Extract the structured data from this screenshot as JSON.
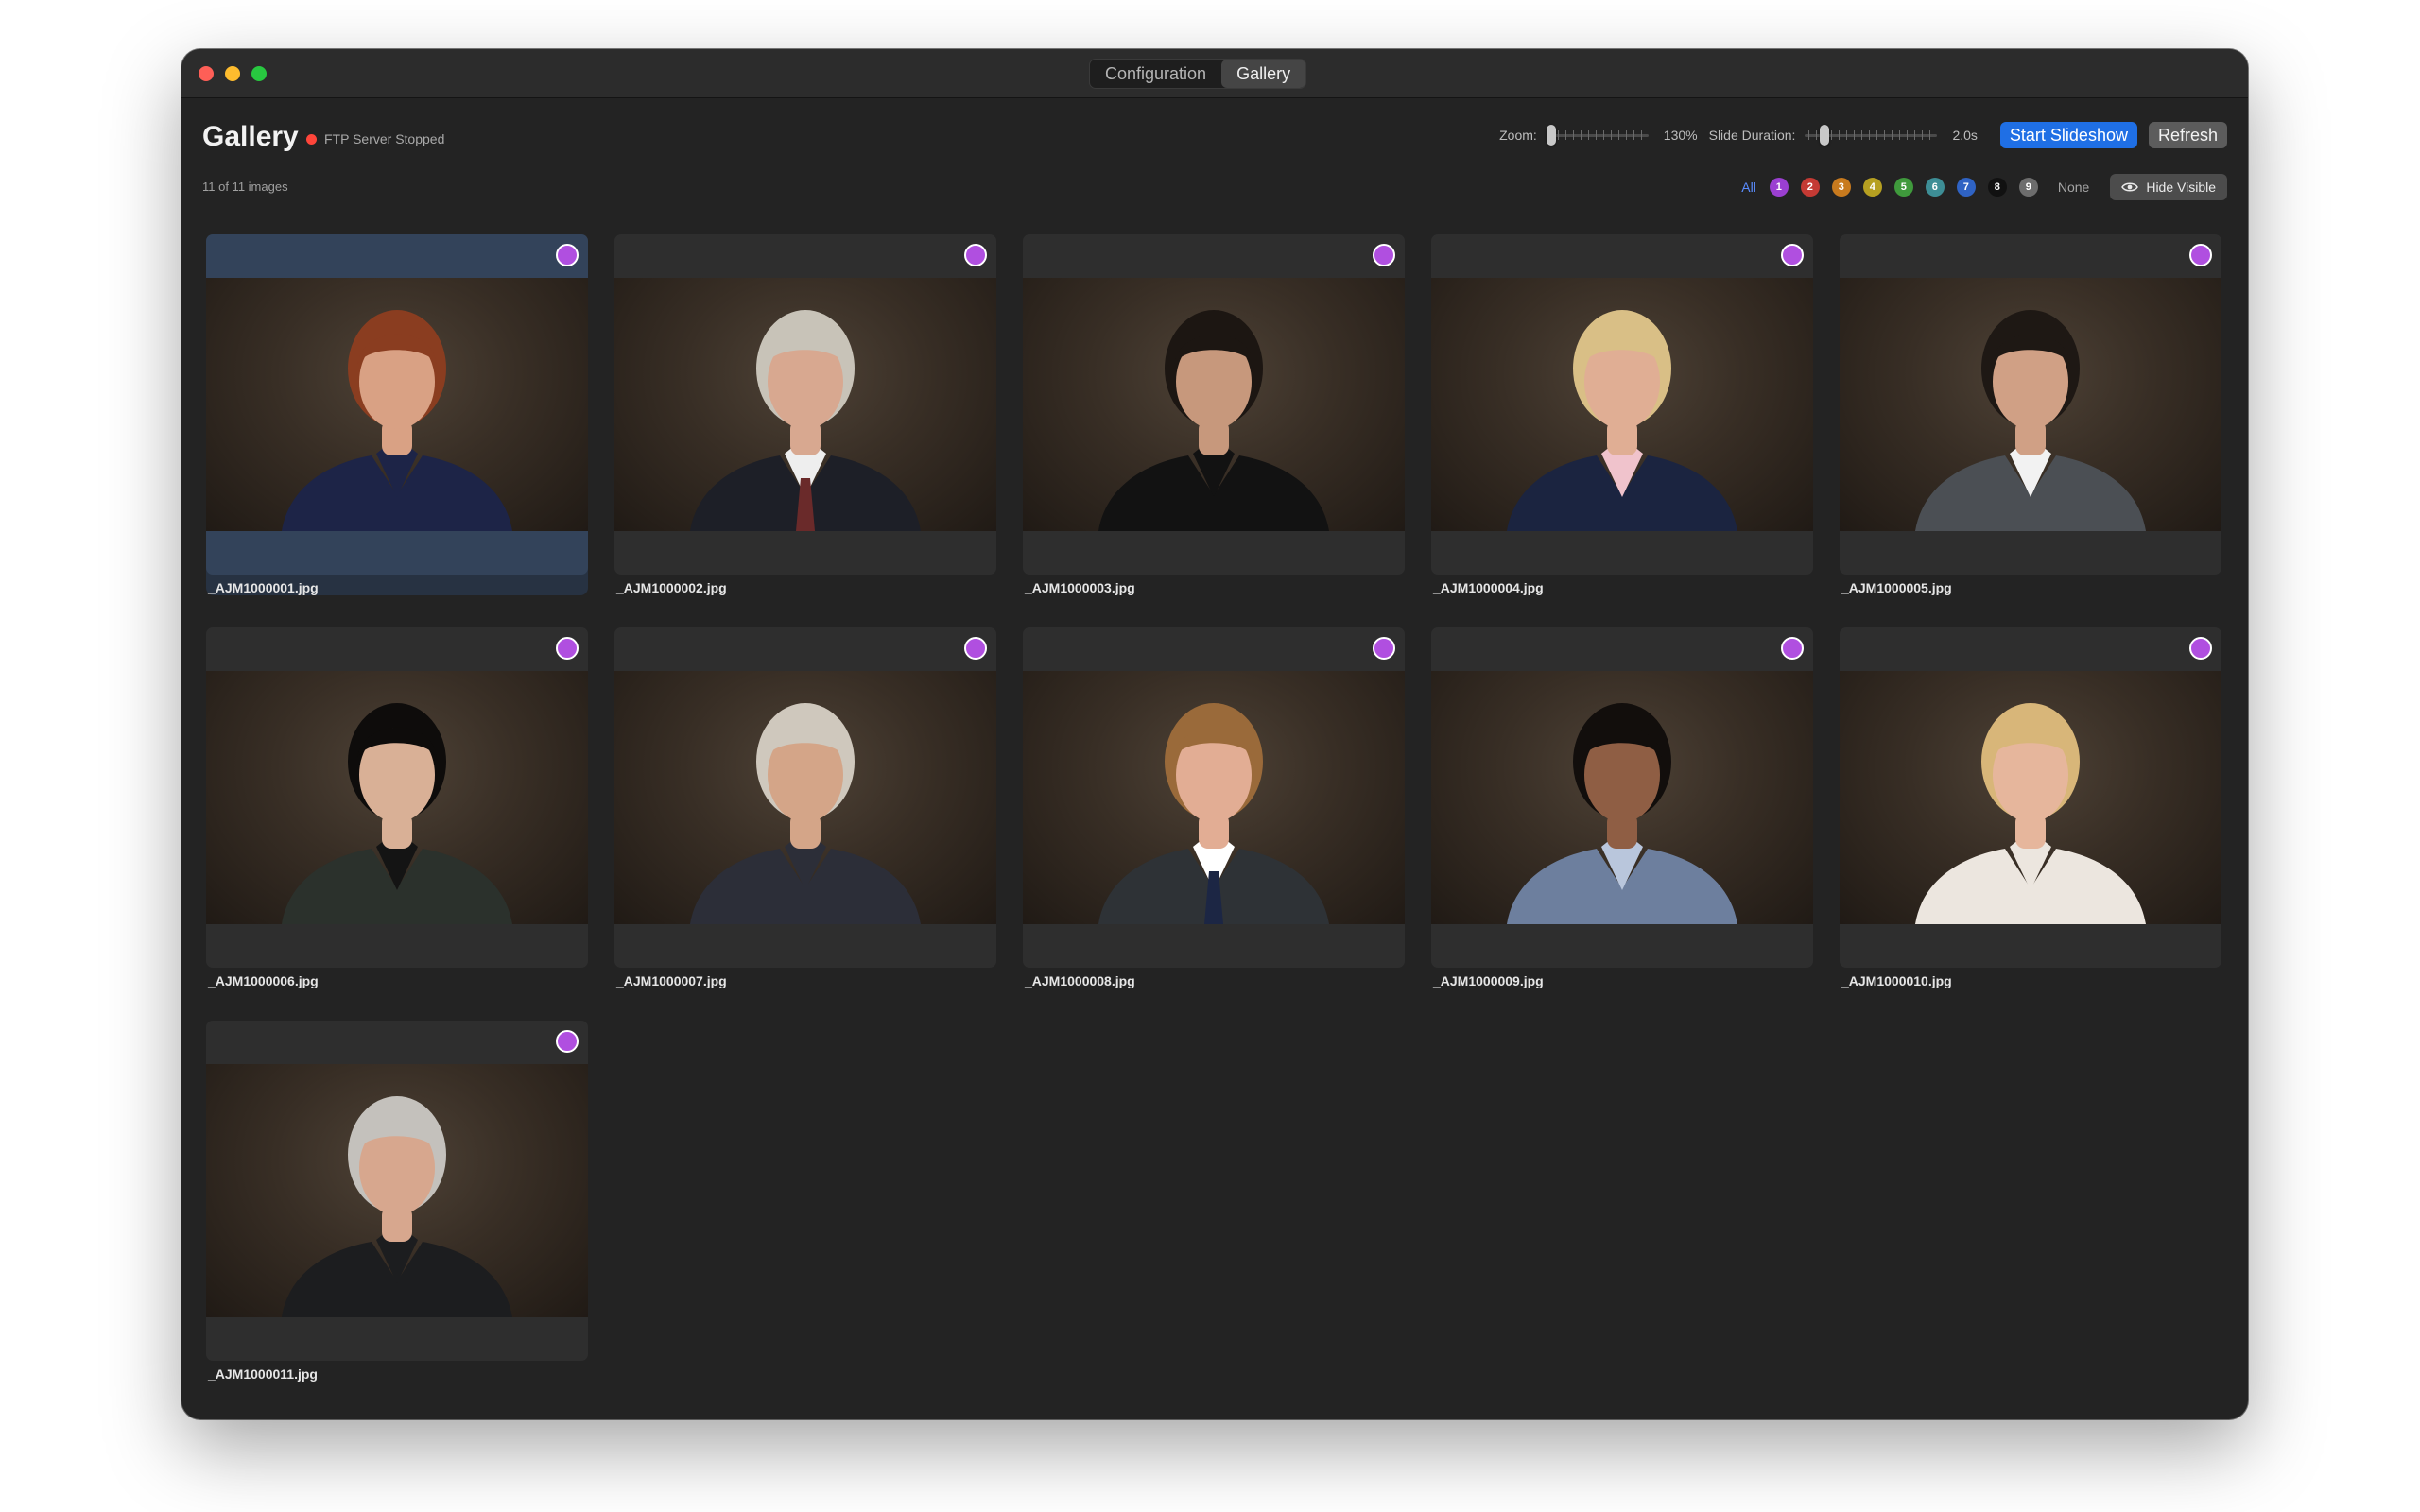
{
  "window": {
    "tabs": [
      {
        "label": "Configuration",
        "active": false
      },
      {
        "label": "Gallery",
        "active": true
      }
    ]
  },
  "header": {
    "title": "Gallery",
    "status_text": "FTP Server Stopped",
    "status_color": "#ff453a",
    "image_count": "11 of 11 images"
  },
  "controls": {
    "zoom_label": "Zoom:",
    "zoom_value": "130%",
    "zoom_fraction": 0.0,
    "duration_label": "Slide Duration:",
    "duration_value": "2.0s",
    "duration_fraction": 0.12,
    "start_slideshow": "Start Slideshow",
    "refresh": "Refresh"
  },
  "filters": {
    "all_label": "All",
    "none_label": "None",
    "hide_visible": "Hide Visible",
    "colors": [
      {
        "label": "1",
        "color": "#9b3fd1"
      },
      {
        "label": "2",
        "color": "#c43a34"
      },
      {
        "label": "3",
        "color": "#c87a1e"
      },
      {
        "label": "4",
        "color": "#b6a021"
      },
      {
        "label": "5",
        "color": "#3f9a3c"
      },
      {
        "label": "6",
        "color": "#3d8e96"
      },
      {
        "label": "7",
        "color": "#2f63c4"
      },
      {
        "label": "8",
        "color": "#111111"
      },
      {
        "label": "9",
        "color": "#6d6d6d"
      }
    ]
  },
  "gallery": {
    "tag_color": "#b04fe0",
    "images": [
      {
        "filename": "_AJM1000001.jpg",
        "selected": true,
        "hair": "#8a3d20",
        "skin": "#d9a184",
        "clothing": "#1d2447",
        "shirt": "#1d2447",
        "tie": ""
      },
      {
        "filename": "_AJM1000002.jpg",
        "selected": false,
        "hair": "#c8c3b8",
        "skin": "#d8a890",
        "clothing": "#1d1f27",
        "shirt": "#eeeeee",
        "tie": "#6a2a2a"
      },
      {
        "filename": "_AJM1000003.jpg",
        "selected": false,
        "hair": "#1c1612",
        "skin": "#c7987c",
        "clothing": "#121212",
        "shirt": "#121212",
        "tie": ""
      },
      {
        "filename": "_AJM1000004.jpg",
        "selected": false,
        "hair": "#d9bf86",
        "skin": "#e0ae94",
        "clothing": "#1b2440",
        "shirt": "#f0c3cc",
        "tie": ""
      },
      {
        "filename": "_AJM1000005.jpg",
        "selected": false,
        "hair": "#1e1814",
        "skin": "#d0a085",
        "clothing": "#4b4f54",
        "shirt": "#f2f2f2",
        "tie": ""
      },
      {
        "filename": "_AJM1000006.jpg",
        "selected": false,
        "hair": "#0e0c0b",
        "skin": "#d9b096",
        "clothing": "#2b312c",
        "shirt": "#141414",
        "tie": ""
      },
      {
        "filename": "_AJM1000007.jpg",
        "selected": false,
        "hair": "#cfc8bd",
        "skin": "#d4a588",
        "clothing": "#2c2e38",
        "shirt": "#2c2e38",
        "tie": ""
      },
      {
        "filename": "_AJM1000008.jpg",
        "selected": false,
        "hair": "#9a6a3a",
        "skin": "#e2ad94",
        "clothing": "#2e3236",
        "shirt": "#ffffff",
        "tie": "#1c2644"
      },
      {
        "filename": "_AJM1000009.jpg",
        "selected": false,
        "hair": "#120e0c",
        "skin": "#8f5e44",
        "clothing": "#6d7f9e",
        "shirt": "#b9c6dc",
        "tie": ""
      },
      {
        "filename": "_AJM1000010.jpg",
        "selected": false,
        "hair": "#d8b679",
        "skin": "#e6b69c",
        "clothing": "#ece6df",
        "shirt": "#ece6df",
        "tie": ""
      },
      {
        "filename": "_AJM1000011.jpg",
        "selected": false,
        "hair": "#c4c1bc",
        "skin": "#d7a78e",
        "clothing": "#1c1d1f",
        "shirt": "#1c1d1f",
        "tie": ""
      }
    ]
  }
}
